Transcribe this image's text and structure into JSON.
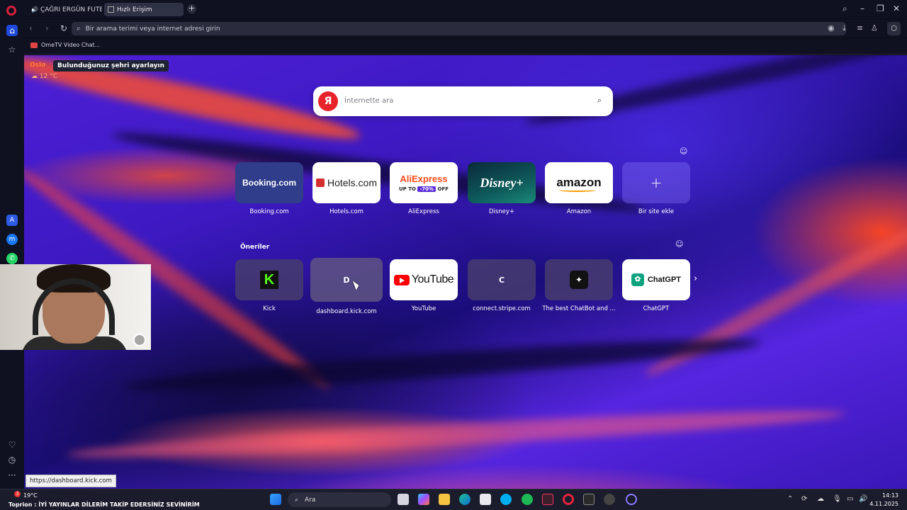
{
  "browser": {
    "tabs": [
      {
        "label": "ÇAĞRI ERGÜN FUTBOL"
      },
      {
        "label": "Hızlı Erişim"
      }
    ],
    "address_placeholder": "Bir arama terimi veya internet adresi girin",
    "bookmarks": [
      {
        "label": "OmeTV Video Chat..."
      }
    ]
  },
  "weather": {
    "city": "Oslo",
    "tooltip": "Bulunduğunuz şehri ayarlayın",
    "temp": "12 °C"
  },
  "search": {
    "placeholder": "İnternette ara",
    "engine_letter": "Я"
  },
  "speed_dials": [
    {
      "label": "Booking.com",
      "logo": "Booking.com"
    },
    {
      "label": "Hotels.com",
      "logo": "Hotels.com"
    },
    {
      "label": "AliExpress",
      "logo": "AliExpress",
      "promo_left": "UP TO",
      "promo_mid": "-70%",
      "promo_right": "OFF"
    },
    {
      "label": "Disney+",
      "logo": "Disney+"
    },
    {
      "label": "Amazon",
      "logo": "amazon"
    },
    {
      "label": "Bir site ekle",
      "logo": "+"
    }
  ],
  "suggestions": {
    "title": "Öneriler",
    "items": [
      {
        "label": "Kick",
        "logo": "K"
      },
      {
        "label": "dashboard.kick.com",
        "logo": "D"
      },
      {
        "label": "YouTube",
        "logo": "YouTube"
      },
      {
        "label": "connect.stripe.com",
        "logo": "C"
      },
      {
        "label": "The best ChatBot and ...",
        "logo": "✦"
      },
      {
        "label": "ChatGPT",
        "logo": "ChatGPT"
      }
    ]
  },
  "status_url": "https://dashboard.kick.com",
  "taskbar": {
    "weather_temp": "19°C",
    "notification_count": "3",
    "ticker": "Toprion : İYİ YAYINLAR DİLERİM TAKİP EDERSİNİZ SEVİNİRİM",
    "search_placeholder": "Ara",
    "time": "14:13",
    "date": "4.11.2025"
  },
  "colors": {
    "accent_blue": "#1f49d9",
    "opera_red": "#d8213a",
    "weather_orange": "#ff7a2e"
  }
}
